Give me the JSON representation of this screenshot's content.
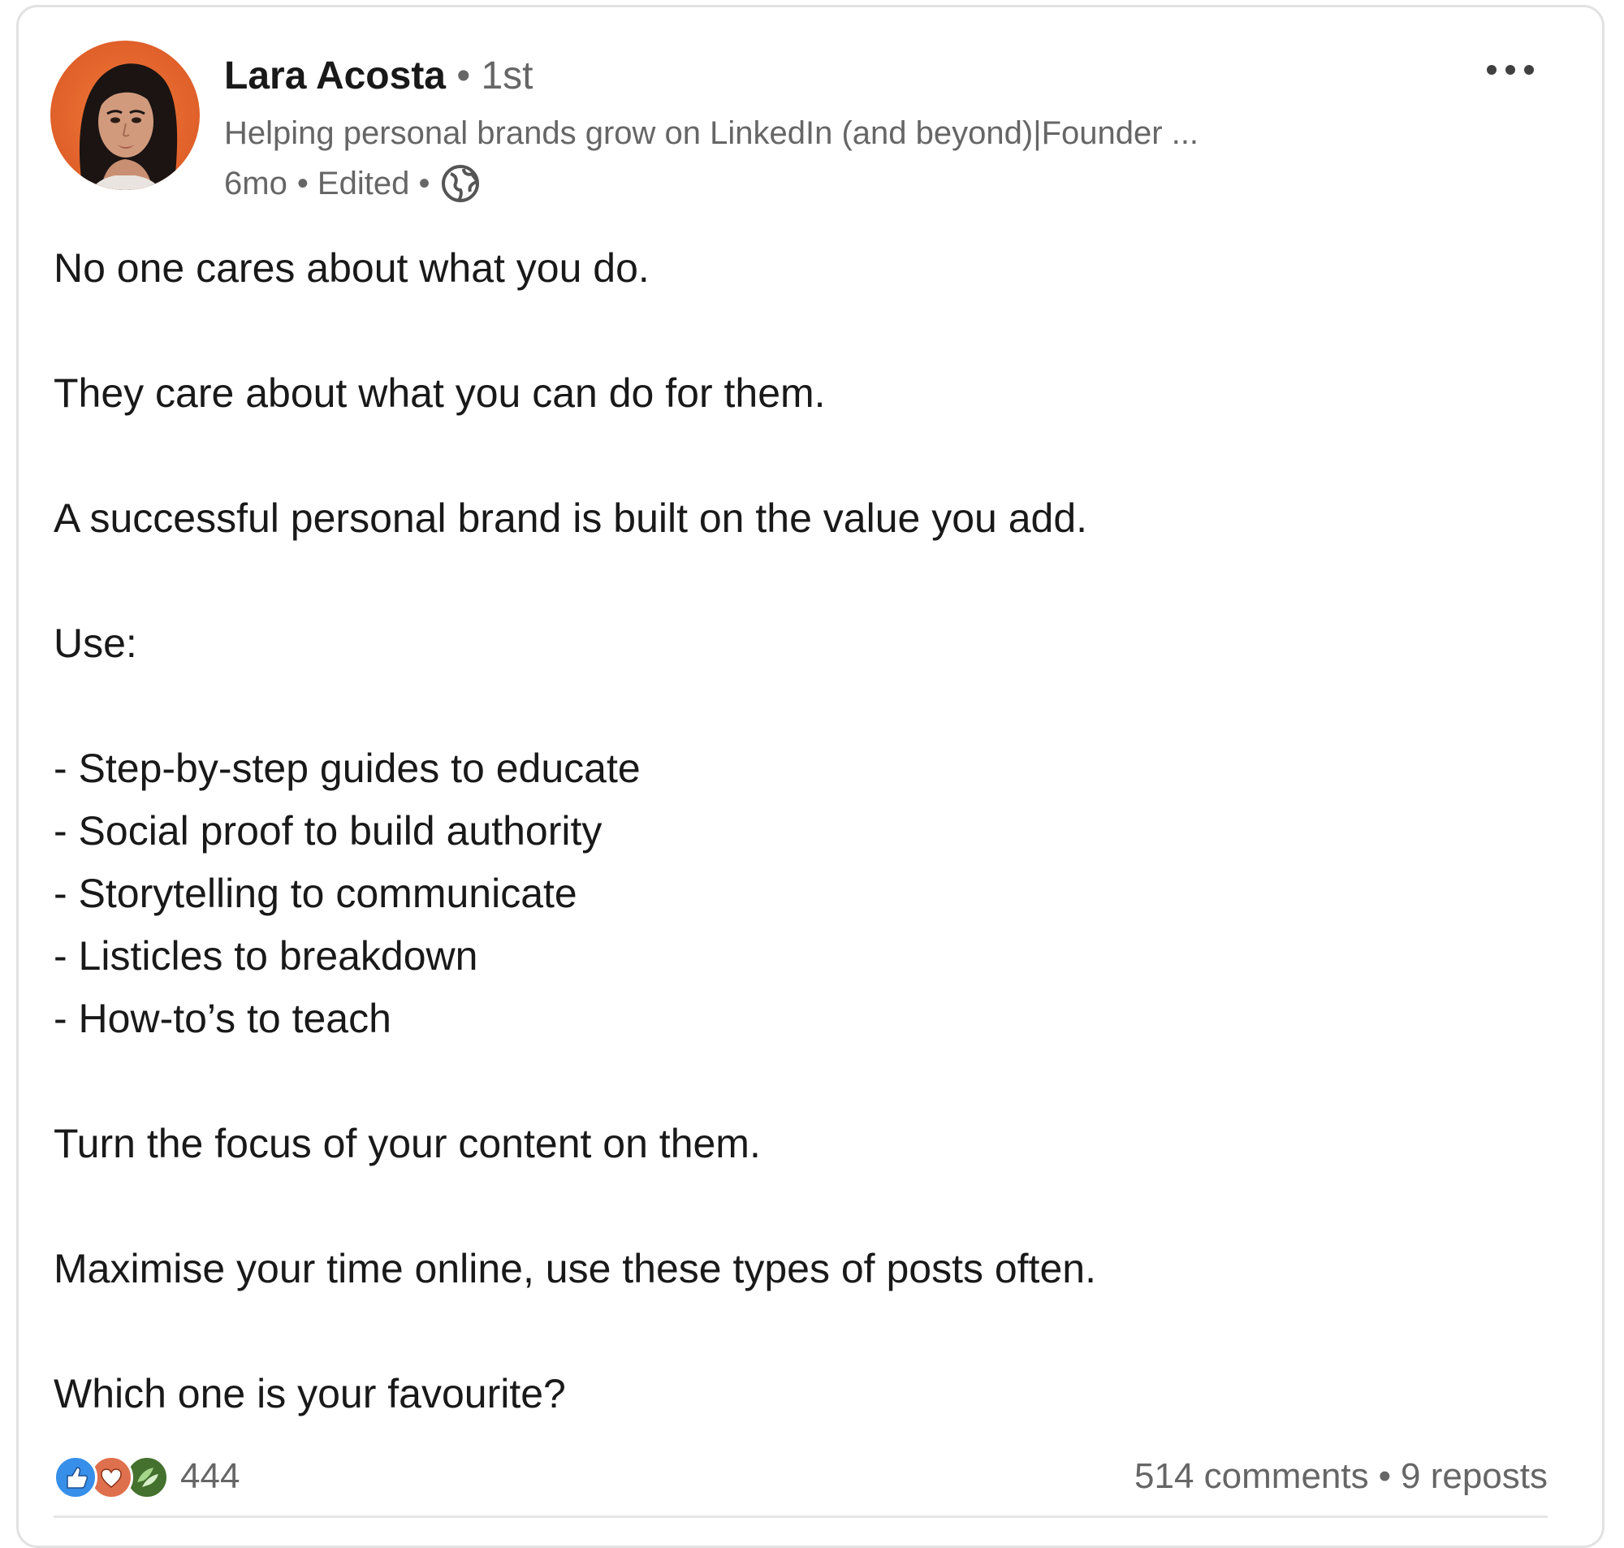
{
  "post": {
    "author": {
      "name": "Lara Acosta",
      "degree": "• 1st",
      "headline": "Helping personal brands grow on LinkedIn (and beyond)|Founder ...",
      "time": "6mo",
      "edited": "• Edited •",
      "visibility_icon": "globe-icon",
      "avatar_bg": "#e0602a"
    },
    "more_icon": "more-horizontal-icon",
    "paragraphs": {
      "p1": "No one cares about what you do.",
      "p2": "They care about what you can do for them.",
      "p3": "A successful personal brand is built on the value you add.",
      "p4": "Use:",
      "list": [
        "- Step-by-step guides to educate",
        "- Social proof to build authority",
        "- Storytelling to communicate",
        "- Listicles to breakdown",
        "- How-to’s to teach"
      ],
      "p5": "Turn the focus of your content on them.",
      "p6": "Maximise your time online, use these types of posts often.",
      "p7": "Which one is your favourite?"
    },
    "social": {
      "reaction_icons": [
        "like-icon",
        "love-icon",
        "support-icon"
      ],
      "reaction_colors": {
        "like": "#378fe9",
        "love": "#df704d",
        "support": "#44712e"
      },
      "reaction_count": "444",
      "comments": "514 comments",
      "separator": "•",
      "reposts": "9 reposts"
    }
  }
}
